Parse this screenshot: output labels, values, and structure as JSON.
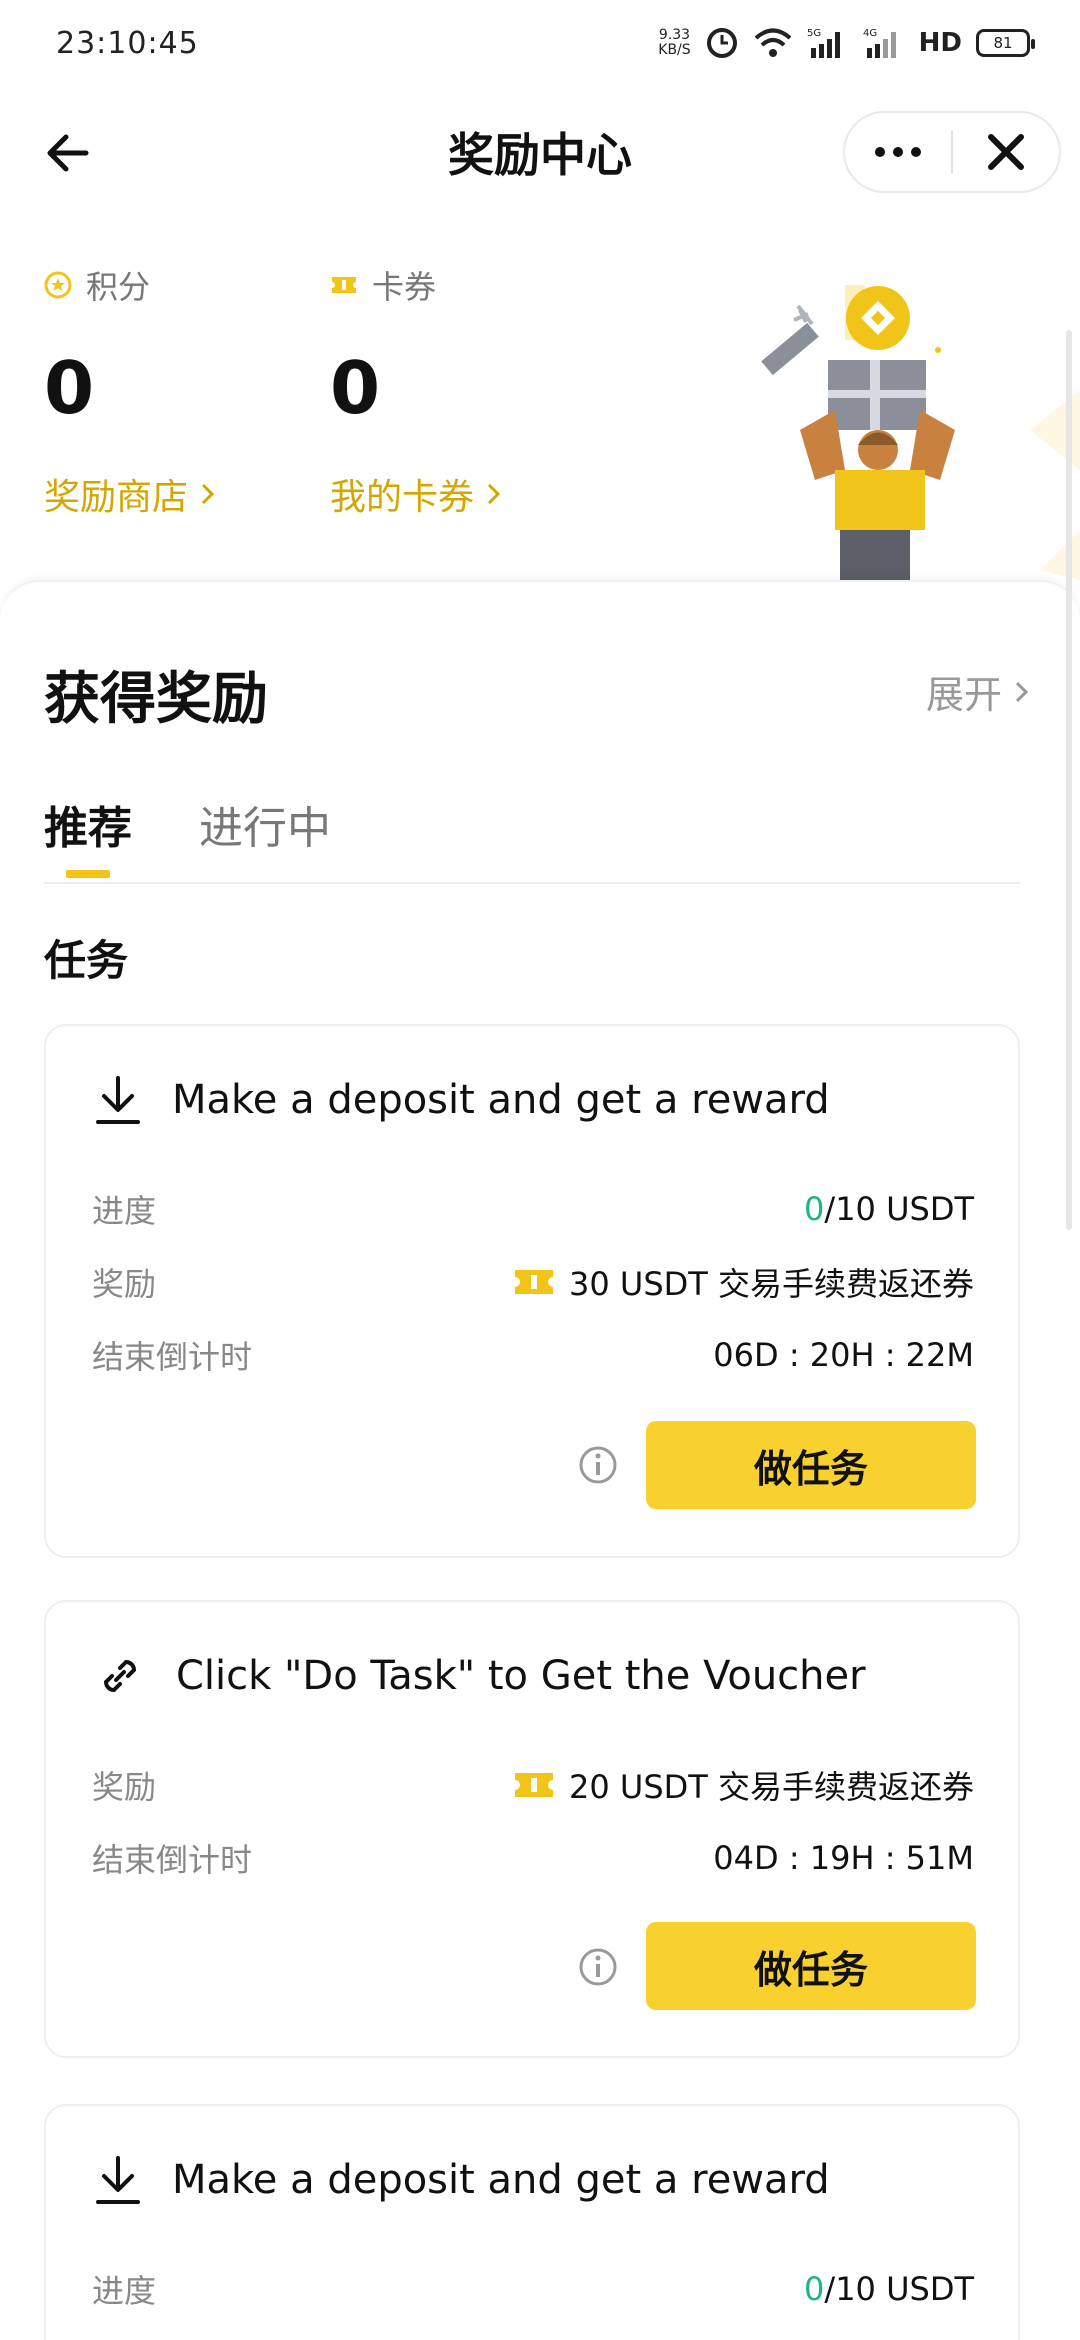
{
  "status_bar": {
    "time": "23:10:45",
    "network_speed": "9.33\nKB/S",
    "hd": "HD",
    "battery": "81"
  },
  "header": {
    "title": "奖励中心",
    "more_icon": "more-dots-icon",
    "close_icon": "close-icon"
  },
  "points": {
    "label": "积分",
    "value": "0",
    "link": "奖励商店"
  },
  "vouchers": {
    "label": "卡券",
    "value": "0",
    "link": "我的卡券"
  },
  "panel": {
    "title": "获得奖励",
    "expand": "展开",
    "tabs": [
      {
        "label": "推荐"
      },
      {
        "label": "进行中"
      }
    ],
    "section_title": "任务"
  },
  "tasks": [
    {
      "title": "Make a deposit and get a reward",
      "icon": "download-icon",
      "progress_label": "进度",
      "progress_done": "0",
      "progress_total": "/10 USDT",
      "reward_label": "奖励",
      "reward": "30 USDT 交易手续费返还券",
      "countdown_label": "结束倒计时",
      "countdown": "06D : 20H : 22M",
      "button": "做任务"
    },
    {
      "title": "Click \"Do Task\" to Get the Voucher",
      "icon": "link-icon",
      "reward_label": "奖励",
      "reward": "20 USDT 交易手续费返还券",
      "countdown_label": "结束倒计时",
      "countdown": "04D : 19H : 51M",
      "button": "做任务"
    },
    {
      "title": "Make a deposit and get a reward",
      "icon": "download-icon",
      "progress_label": "进度",
      "progress_done": "0",
      "progress_total": "/10 USDT"
    }
  ],
  "colors": {
    "accent": "#f8d12f",
    "link": "#d4a700",
    "progress_zero": "#1fb583"
  }
}
